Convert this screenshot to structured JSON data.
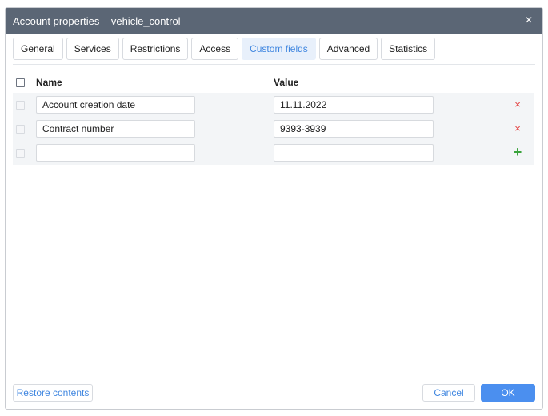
{
  "dialog": {
    "title": "Account properties – vehicle_control",
    "close_glyph": "×"
  },
  "tabs": [
    {
      "label": "General",
      "active": false
    },
    {
      "label": "Services",
      "active": false
    },
    {
      "label": "Restrictions",
      "active": false
    },
    {
      "label": "Access",
      "active": false
    },
    {
      "label": "Custom fields",
      "active": true
    },
    {
      "label": "Advanced",
      "active": false
    },
    {
      "label": "Statistics",
      "active": false
    }
  ],
  "table": {
    "columns": {
      "name": "Name",
      "value": "Value"
    },
    "rows": [
      {
        "name": "Account creation date",
        "value": "11.11.2022"
      },
      {
        "name": "Contract number",
        "value": "9393-3939"
      }
    ],
    "new_row": {
      "name": "",
      "value": ""
    },
    "remove_glyph": "×",
    "add_glyph": "+"
  },
  "footer": {
    "restore_label": "Restore contents",
    "cancel_label": "Cancel",
    "ok_label": "OK"
  },
  "colors": {
    "titlebar": "#5b6675",
    "accent": "#4b8fef",
    "remove": "#e23b3b",
    "add": "#3aa33c"
  }
}
